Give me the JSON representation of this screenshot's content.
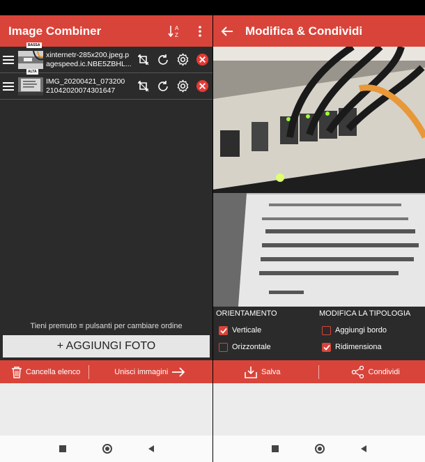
{
  "left": {
    "app_title": "Image Combiner",
    "images": [
      {
        "quality": "BASSA",
        "name_line1": "xinternetr-285x200.jpeg.p",
        "name_line2": "agespeed.ic.NBE5ZBHL..."
      },
      {
        "quality": "ALTA",
        "name_line1": "IMG_20200421_073200",
        "name_line2": "21042020074301647"
      }
    ],
    "hint": "Tieni premuto ≡ pulsanti per cambiare ordine",
    "add_button": "+ AGGIUNGI FOTO",
    "clear_label": "Cancella elenco",
    "combine_label": "Unisci immagini"
  },
  "right": {
    "title": "Modifica & Condividi",
    "orientation_header": "ORIENTAMENTO",
    "orientation_vertical": "Verticale",
    "orientation_horizontal": "Orizzontale",
    "vertical_checked": true,
    "horizontal_checked": false,
    "modify_header": "MODIFICA LA TIPOLOGIA",
    "add_border": "Aggiungi bordo",
    "resize": "Ridimensiona",
    "add_border_checked": false,
    "resize_checked": true,
    "save_label": "Salva",
    "share_label": "Condividi"
  },
  "colors": {
    "accent": "#d9443a",
    "background": "#2b2b2b"
  }
}
